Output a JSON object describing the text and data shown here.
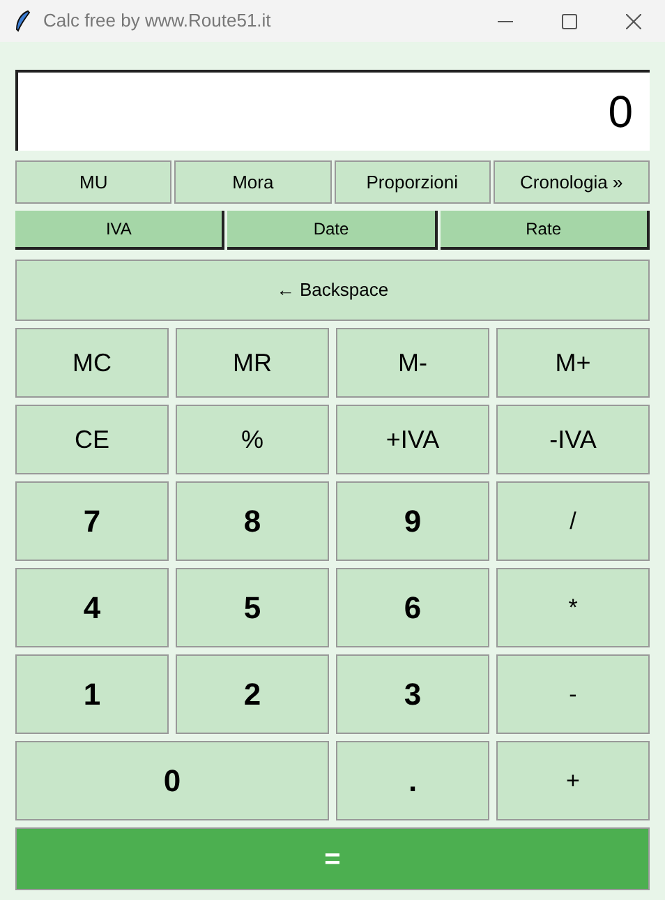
{
  "window": {
    "title": "Calc free by www.Route51.it"
  },
  "display": {
    "value": "0"
  },
  "tool_buttons": [
    "MU",
    "Mora",
    "Proporzioni",
    "Cronologia »"
  ],
  "mode_buttons": [
    "IVA",
    "Date",
    "Rate"
  ],
  "backspace": "← Backspace",
  "keys": [
    {
      "label": "MC",
      "kind": "function"
    },
    {
      "label": "MR",
      "kind": "function"
    },
    {
      "label": "M-",
      "kind": "function"
    },
    {
      "label": "M+",
      "kind": "function"
    },
    {
      "label": "CE",
      "kind": "function"
    },
    {
      "label": "%",
      "kind": "function"
    },
    {
      "label": "+IVA",
      "kind": "function"
    },
    {
      "label": "-IVA",
      "kind": "function"
    },
    {
      "label": "7",
      "kind": "digit"
    },
    {
      "label": "8",
      "kind": "digit"
    },
    {
      "label": "9",
      "kind": "digit"
    },
    {
      "label": "/",
      "kind": "operator"
    },
    {
      "label": "4",
      "kind": "digit"
    },
    {
      "label": "5",
      "kind": "digit"
    },
    {
      "label": "6",
      "kind": "digit"
    },
    {
      "label": "*",
      "kind": "operator"
    },
    {
      "label": "1",
      "kind": "digit"
    },
    {
      "label": "2",
      "kind": "digit"
    },
    {
      "label": "3",
      "kind": "digit"
    },
    {
      "label": "-",
      "kind": "operator"
    },
    {
      "label": "0",
      "kind": "digit",
      "wide": true
    },
    {
      "label": ".",
      "kind": "digit"
    },
    {
      "label": "+",
      "kind": "operator"
    }
  ],
  "equals": "="
}
